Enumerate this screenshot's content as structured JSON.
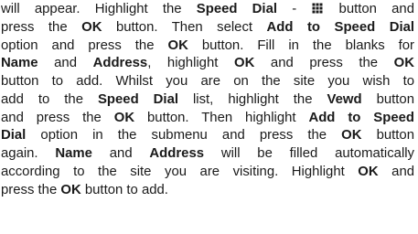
{
  "text_color": "#1a1a1a",
  "icon": "speed-dial-grid-icon",
  "lines": [
    [
      "will appear. Highlight the ",
      {
        "b": "Speed Dial"
      },
      " - ",
      {
        "icon": true
      },
      " button and"
    ],
    [
      "press the ",
      {
        "b": "OK"
      },
      " button. Then select ",
      {
        "b": "Add to Speed Dial"
      }
    ],
    [
      "option and press the ",
      {
        "b": "OK"
      },
      " button. Fill in the blanks for"
    ],
    [
      {
        "b": "Name"
      },
      " and ",
      {
        "b": "Address"
      },
      ", highlight ",
      {
        "b": "OK"
      },
      " and press the ",
      {
        "b": "OK"
      }
    ],
    [
      "button to add. Whilst you are on the site you wish to"
    ],
    [
      "add to the ",
      {
        "b": "Speed Dial"
      },
      " list, highlight the ",
      {
        "b": "Vewd"
      },
      " button"
    ],
    [
      "and press the ",
      {
        "b": "OK"
      },
      " button. Then highlight ",
      {
        "b": "Add to Speed"
      }
    ],
    [
      {
        "b": "Dial"
      },
      " option in the submenu and press the ",
      {
        "b": "OK"
      },
      " button"
    ],
    [
      "again. ",
      {
        "b": "Name"
      },
      " and ",
      {
        "b": "Address"
      },
      " will be filled automatically"
    ],
    [
      "according to the site you are visiting. Highlight ",
      {
        "b": "OK"
      },
      " and"
    ],
    [
      "press the ",
      {
        "b": "OK"
      },
      " button to add."
    ]
  ]
}
